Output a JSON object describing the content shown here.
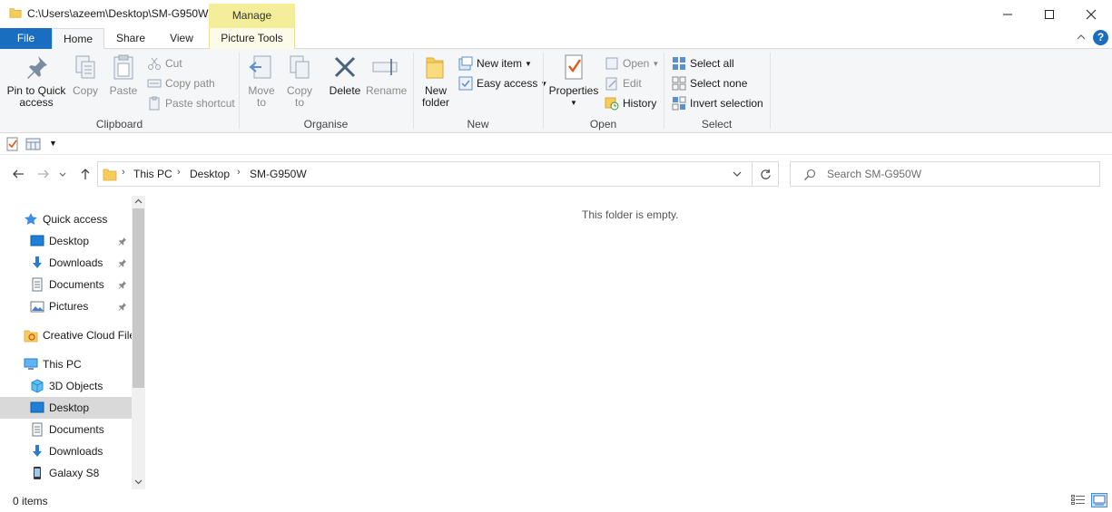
{
  "window": {
    "title": "C:\\Users\\azeem\\Desktop\\SM-G950W",
    "manage_tab": "Manage"
  },
  "tabs": [
    {
      "label": "File"
    },
    {
      "label": "Home"
    },
    {
      "label": "Share"
    },
    {
      "label": "View"
    },
    {
      "label": "Picture Tools"
    }
  ],
  "ribbon": {
    "clipboard": {
      "label": "Clipboard",
      "pin_line1": "Pin to Quick",
      "pin_line2": "access",
      "copy": "Copy",
      "paste": "Paste",
      "cut": "Cut",
      "copy_path": "Copy path",
      "paste_shortcut": "Paste shortcut"
    },
    "organise": {
      "label": "Organise",
      "move_line1": "Move",
      "move_line2": "to",
      "copy_line1": "Copy",
      "copy_line2": "to",
      "delete": "Delete",
      "rename": "Rename"
    },
    "new": {
      "label": "New",
      "folder_line1": "New",
      "folder_line2": "folder",
      "new_item": "New item",
      "easy_access": "Easy access"
    },
    "open": {
      "label": "Open",
      "properties": "Properties",
      "open": "Open",
      "edit": "Edit",
      "history": "History"
    },
    "select": {
      "label": "Select",
      "select_all": "Select all",
      "select_none": "Select none",
      "invert": "Invert selection"
    }
  },
  "address": {
    "parts": [
      "This PC",
      "Desktop",
      "SM-G950W"
    ]
  },
  "search": {
    "placeholder": "Search SM-G950W"
  },
  "nav": {
    "items": [
      {
        "label": "Quick access"
      },
      {
        "label": "Desktop"
      },
      {
        "label": "Downloads"
      },
      {
        "label": "Documents"
      },
      {
        "label": "Pictures"
      },
      {
        "label": "Creative Cloud Files"
      },
      {
        "label": "This PC"
      },
      {
        "label": "3D Objects"
      },
      {
        "label": "Desktop"
      },
      {
        "label": "Documents"
      },
      {
        "label": "Downloads"
      },
      {
        "label": "Galaxy S8"
      }
    ]
  },
  "content": {
    "empty_message": "This folder is empty."
  },
  "status": {
    "items": "0 items"
  },
  "colors": {
    "file_tab": "#1a6ec0",
    "manage_tab": "#f4ee9b",
    "selected_nav": "#d9d9d9",
    "folder_yellow": "#f7cd5a"
  }
}
